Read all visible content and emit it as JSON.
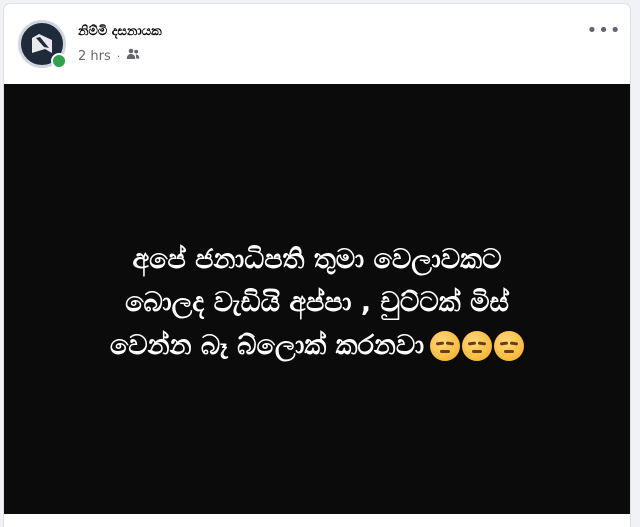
{
  "post": {
    "author_name": "නිම්මි දසනායක",
    "timestamp": "2 hrs",
    "separator": "·",
    "audience_icon": "friends-icon",
    "more_icon": "more-options-icon",
    "more_label": "•••",
    "online": true,
    "status_color": "#31a24c"
  },
  "image": {
    "lines": [
      "අපේ ජනාධිපති තුමා වෙලාවකට",
      "බොලද වැඩියි අප්පා , චුට්ටක් මිස්",
      "වෙන්න බෑ බ්ලොක් කරනවා"
    ],
    "emoji": [
      "unamused-face",
      "unamused-face",
      "unamused-face"
    ],
    "background_color": "#0b0b0b",
    "text_color": "#ffffff"
  }
}
